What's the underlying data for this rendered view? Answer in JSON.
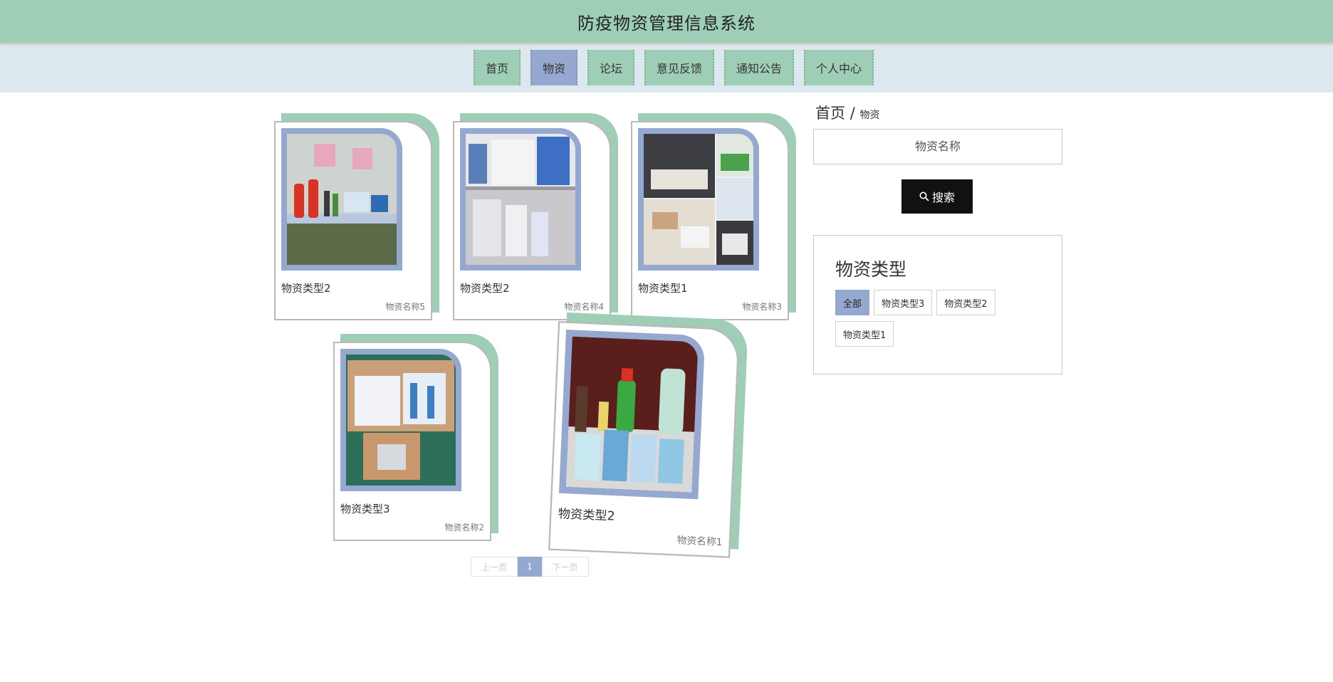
{
  "header": {
    "title": "防疫物资管理信息系统"
  },
  "nav": {
    "items": [
      {
        "label": "首页",
        "active": false
      },
      {
        "label": "物资",
        "active": true
      },
      {
        "label": "论坛",
        "active": false
      },
      {
        "label": "意见反馈",
        "active": false
      },
      {
        "label": "通知公告",
        "active": false
      },
      {
        "label": "个人中心",
        "active": false
      }
    ]
  },
  "products": [
    {
      "type": "物资类型2",
      "name": "物资名称5",
      "photo": "sanitizer-bottles-on-table"
    },
    {
      "type": "物资类型2",
      "name": "物资名称4",
      "photo": "supply-cabinet"
    },
    {
      "type": "物资类型1",
      "name": "物资名称3",
      "photo": "storage-collage"
    },
    {
      "type": "物资类型3",
      "name": "物资名称2",
      "photo": "cardboard-boxes-of-masks"
    },
    {
      "type": "物资类型2",
      "name": "物资名称1",
      "photo": "spray-bottles-and-masks"
    }
  ],
  "pagination": {
    "prev": "上一页",
    "current": "1",
    "next": "下一页"
  },
  "breadcrumb": {
    "home": "首页",
    "separator": "/",
    "current": "物资"
  },
  "search": {
    "placeholder": "物资名称",
    "button_label": "搜索",
    "button_icon": "search-icon"
  },
  "filter": {
    "title": "物资类型",
    "tags": [
      {
        "label": "全部",
        "active": true
      },
      {
        "label": "物资类型3",
        "active": false
      },
      {
        "label": "物资类型2",
        "active": false
      },
      {
        "label": "物资类型1",
        "active": false
      }
    ]
  },
  "colors": {
    "green": "#9ecfb6",
    "blue": "#95a8d0",
    "nav_bg": "#dce8ee",
    "search_button": "#111111"
  }
}
